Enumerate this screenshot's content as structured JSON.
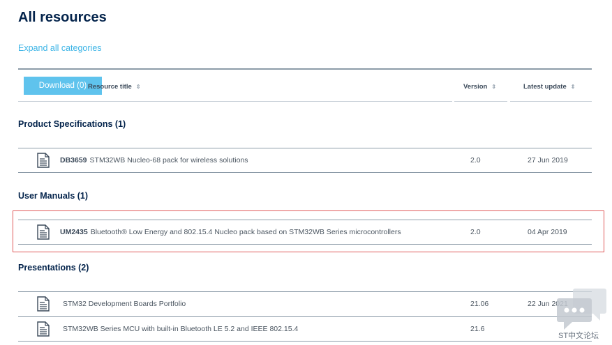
{
  "page": {
    "title": "All resources",
    "expand_label": "Expand all categories"
  },
  "table_header": {
    "download_label": "Download (0)",
    "col_title": "Resource title",
    "col_version": "Version",
    "col_update": "Latest update",
    "sort_glyph": "⇕"
  },
  "sections": [
    {
      "title": "Product Specifications (1)",
      "rows": [
        {
          "code": "DB3659",
          "title": "STM32WB Nucleo-68 pack for wireless solutions",
          "version": "2.0",
          "update": "27 Jun 2019"
        }
      ]
    },
    {
      "title": "User Manuals (1)",
      "rows": [
        {
          "code": "UM2435",
          "title": "Bluetooth® Low Energy and 802.15.4 Nucleo pack based on STM32WB Series microcontrollers",
          "version": "2.0",
          "update": "04 Apr 2019"
        }
      ]
    },
    {
      "title": "Presentations (2)",
      "rows": [
        {
          "code": "",
          "title": "STM32 Development Boards Portfolio",
          "version": "21.06",
          "update": "22 Jun 2021"
        },
        {
          "code": "",
          "title": "STM32WB Series MCU with built-in Bluetooth LE 5.2 and IEEE 802.15.4",
          "version": "21.6",
          "update": ""
        }
      ]
    }
  ],
  "watermark": {
    "label": "ST中文论坛"
  },
  "colors": {
    "brand_dark": "#03234b",
    "link": "#3cb4e6",
    "button": "#5fc3ed",
    "highlight": "#e05a5a"
  },
  "icons": {
    "document": "document-icon",
    "sort": "sort-icon",
    "chat": "chat-bubble-icon"
  }
}
